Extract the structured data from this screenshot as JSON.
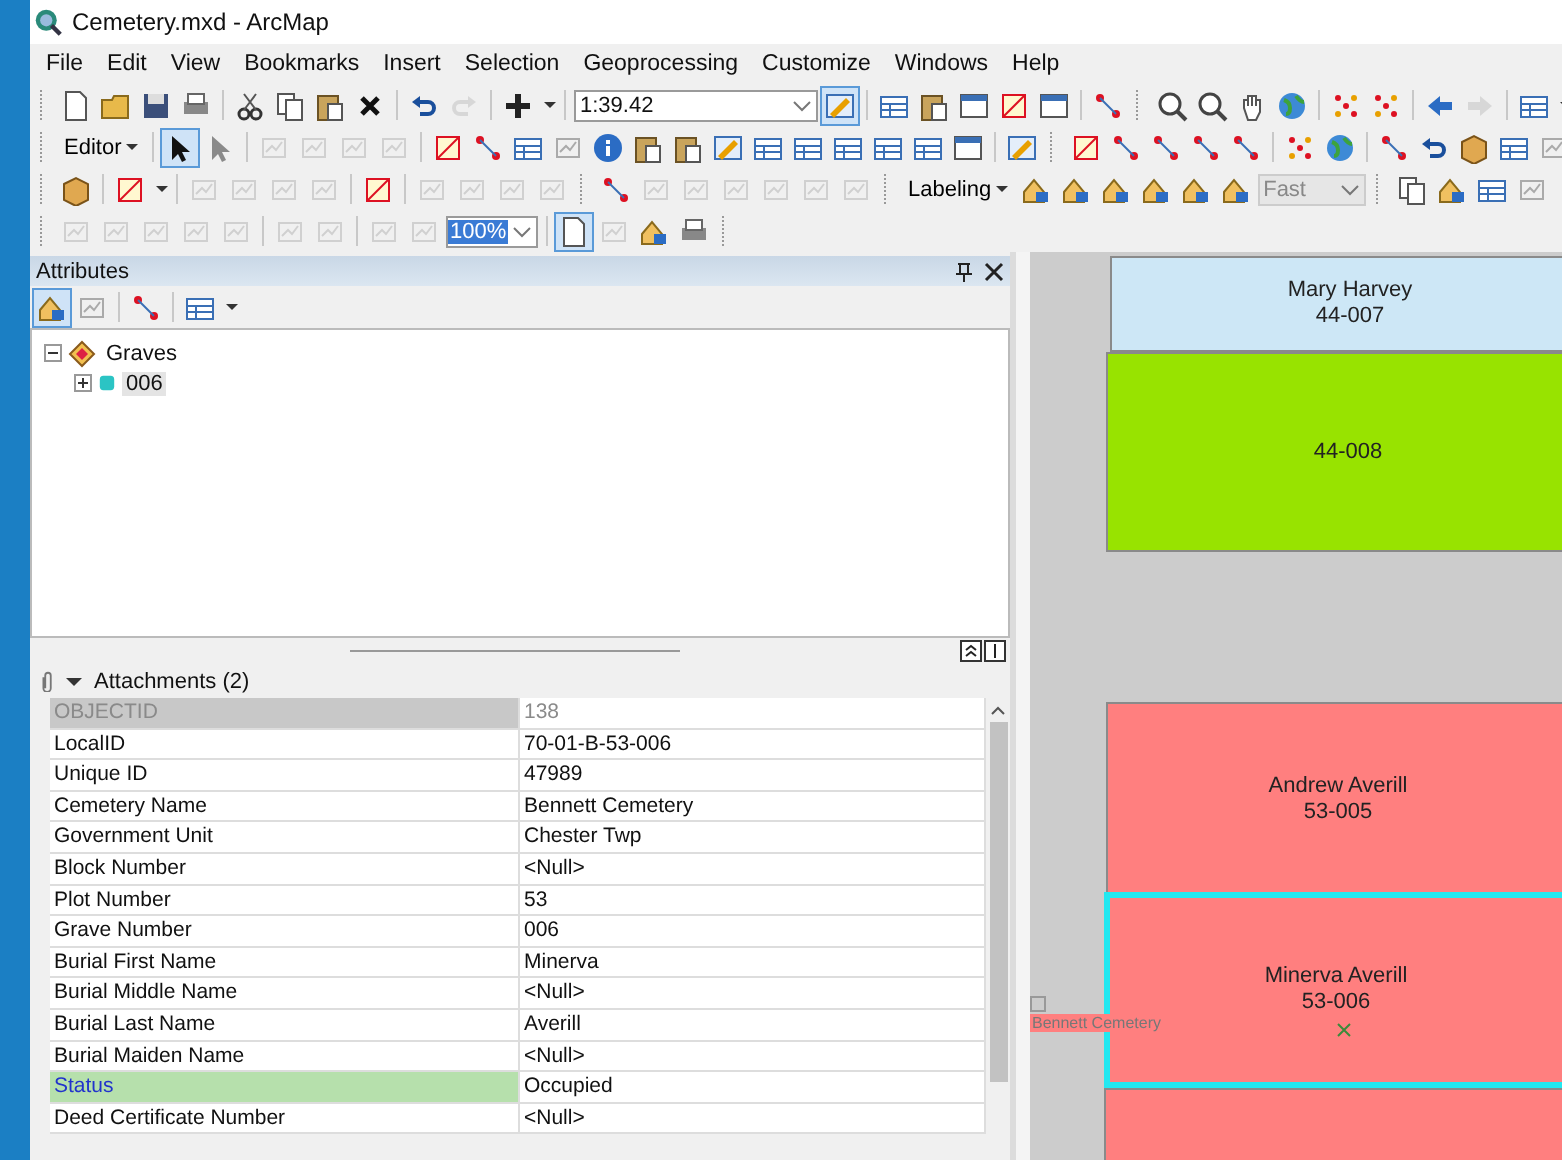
{
  "window": {
    "title": "Cemetery.mxd - ArcMap"
  },
  "menu": [
    "File",
    "Edit",
    "View",
    "Bookmarks",
    "Insert",
    "Selection",
    "Geoprocessing",
    "Customize",
    "Windows",
    "Help"
  ],
  "toolbars": {
    "scale": "1:39.42",
    "editor": "Editor",
    "labeling": "Labeling",
    "label_quality": "Fast",
    "zoom": "100%"
  },
  "attributes": {
    "title": "Attributes",
    "tree": [
      {
        "label": "Graves",
        "expanded": true,
        "selected": false,
        "children": [
          {
            "label": "006",
            "expanded": false,
            "selected": true
          }
        ]
      }
    ],
    "attachments": {
      "label": "Attachments (2)",
      "expanded": true
    },
    "rows": [
      {
        "field": "OBJECTID",
        "value": "138",
        "disabled": true,
        "selected": false
      },
      {
        "field": "LocalID",
        "value": "70-01-B-53-006",
        "disabled": false,
        "selected": false
      },
      {
        "field": "Unique ID",
        "value": "47989",
        "disabled": false,
        "selected": false
      },
      {
        "field": "Cemetery Name",
        "value": "Bennett Cemetery",
        "disabled": false,
        "selected": false
      },
      {
        "field": "Government Unit",
        "value": "Chester Twp",
        "disabled": false,
        "selected": false
      },
      {
        "field": "Block Number",
        "value": "<Null>",
        "disabled": false,
        "selected": false
      },
      {
        "field": "Plot Number",
        "value": "53",
        "disabled": false,
        "selected": false
      },
      {
        "field": "Grave Number",
        "value": "006",
        "disabled": false,
        "selected": false
      },
      {
        "field": "Burial First Name",
        "value": "Minerva",
        "disabled": false,
        "selected": false
      },
      {
        "field": "Burial Middle Name",
        "value": "<Null>",
        "disabled": false,
        "selected": false
      },
      {
        "field": "Burial Last Name",
        "value": "Averill",
        "disabled": false,
        "selected": false
      },
      {
        "field": "Burial Maiden Name",
        "value": "<Null>",
        "disabled": false,
        "selected": false
      },
      {
        "field": "Status",
        "value": "Occupied",
        "disabled": false,
        "selected": true
      },
      {
        "field": "Deed Certificate Number",
        "value": "<Null>",
        "disabled": false,
        "selected": false
      }
    ]
  },
  "map": {
    "parcels": [
      {
        "lines": [
          "Mary Harvey",
          "44-007"
        ],
        "color": "#cde7f6",
        "selected": false
      },
      {
        "lines": [
          "44-008"
        ],
        "color": "#98e300",
        "selected": false
      },
      {
        "lines": [
          "Andrew Averill",
          "53-005"
        ],
        "color": "#ff7f7f",
        "selected": false
      },
      {
        "lines": [
          "Minerva Averill",
          "53-006"
        ],
        "color": "#ff7f7f",
        "selected": true
      },
      {
        "color": "#ff7f7f",
        "selected": false
      }
    ],
    "cemetery_label": "Bennett Cemetery"
  }
}
